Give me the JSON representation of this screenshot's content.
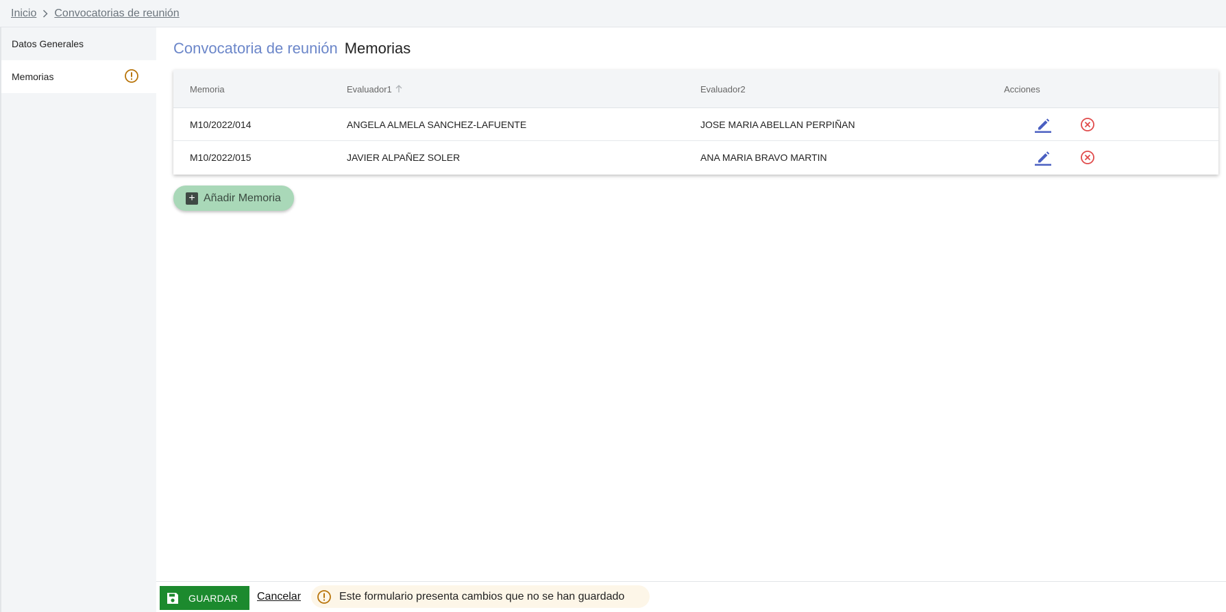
{
  "breadcrumb": {
    "home": "Inicio",
    "current": "Convocatorias de reunión"
  },
  "sidebar": {
    "items": [
      {
        "label": "Datos Generales",
        "active": false
      },
      {
        "label": "Memorias",
        "active": true,
        "icon": "warning-icon"
      }
    ]
  },
  "page": {
    "title_entity": "Convocatoria de reunión",
    "title_section": "Memorias"
  },
  "table": {
    "headers": {
      "memoria": "Memoria",
      "evaluador1": "Evaluador1",
      "evaluador2": "Evaluador2",
      "acciones": "Acciones"
    },
    "sort": {
      "column": "evaluador1",
      "direction": "asc"
    },
    "rows": [
      {
        "memoria": "M10/2022/014",
        "evaluador1": "ANGELA ALMELA SANCHEZ-LAFUENTE",
        "evaluador2": "JOSE MARIA ABELLAN PERPIÑAN"
      },
      {
        "memoria": "M10/2022/015",
        "evaluador1": "JAVIER ALPAÑEZ SOLER",
        "evaluador2": "ANA MARIA BRAVO MARTIN"
      }
    ]
  },
  "actions": {
    "add_label": "Añadir Memoria"
  },
  "footer": {
    "save_label": "GUARDAR",
    "cancel_label": "Cancelar",
    "warning_text": "Este formulario presenta cambios que no se han guardado"
  },
  "colors": {
    "accent": "#6b86c9",
    "save": "#1c8a2e",
    "add_button": "#a9d8b8",
    "warning": "#b8740a",
    "delete": "#e04a4a"
  }
}
